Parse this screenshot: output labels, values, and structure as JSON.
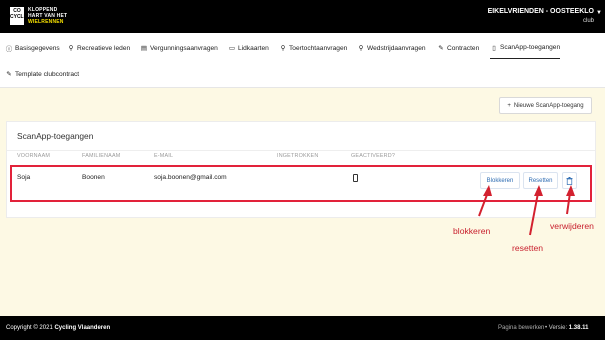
{
  "header": {
    "logo_badge_lines": [
      "CO",
      "CYCLING"
    ],
    "logo_lines": [
      "KLOPPEND",
      "HART VAN HET",
      "WIELRENNEN"
    ],
    "club_name": "EIKELVRIENDEN - OOSTEEKLO",
    "club_role": "club"
  },
  "nav": {
    "items": [
      {
        "label": "Basisgegevens",
        "icon": "info-circle-icon"
      },
      {
        "label": "Recreatieve leden",
        "icon": "bicycle-icon"
      },
      {
        "label": "Vergunningsaanvragen",
        "icon": "book-icon"
      },
      {
        "label": "Lidkaarten",
        "icon": "id-card-icon"
      },
      {
        "label": "Toertochtaanvragen",
        "icon": "bicycle-icon"
      },
      {
        "label": "Wedstrijdaanvragen",
        "icon": "bicycle-icon"
      },
      {
        "label": "Contracten",
        "icon": "contract-icon"
      },
      {
        "label": "ScanApp-toegangen",
        "icon": "mobile-icon"
      },
      {
        "label": "Template clubcontract",
        "icon": "contract-icon"
      }
    ],
    "active": "ScanApp-toegangen"
  },
  "toolbar": {
    "new_label": "Nieuwe ScanApp-toegang"
  },
  "card": {
    "title": "ScanApp-toegangen",
    "columns": [
      "VOORNAAM",
      "FAMILIENAAM",
      "E-MAIL",
      "INGETROKKEN",
      "GEACTIVEERD?"
    ],
    "rows": [
      {
        "voornaam": "Soja",
        "familienaam": "Boonen",
        "email": "soja.boonen@gmail.com",
        "ingetrokken": "",
        "geactiveerd_icon": "mobile-icon"
      }
    ],
    "actions": {
      "block_label": "Blokkeren",
      "reset_label": "Resetten",
      "delete_icon": "trash-icon"
    }
  },
  "annotations": {
    "block": "blokkeren",
    "reset": "resetten",
    "delete": "verwijderen"
  },
  "footer": {
    "copyright_prefix": "Copyright © 2021",
    "copyright_org": "Cycling Vlaanderen",
    "edit_link": "Pagina bewerken",
    "version_prefix": "• Versie:",
    "version": "1.38.11"
  },
  "colors": {
    "annotation": "#c8202e",
    "header_bg": "#000000",
    "page_bg": "#fdf9e4",
    "action_text": "#2f6db3"
  }
}
